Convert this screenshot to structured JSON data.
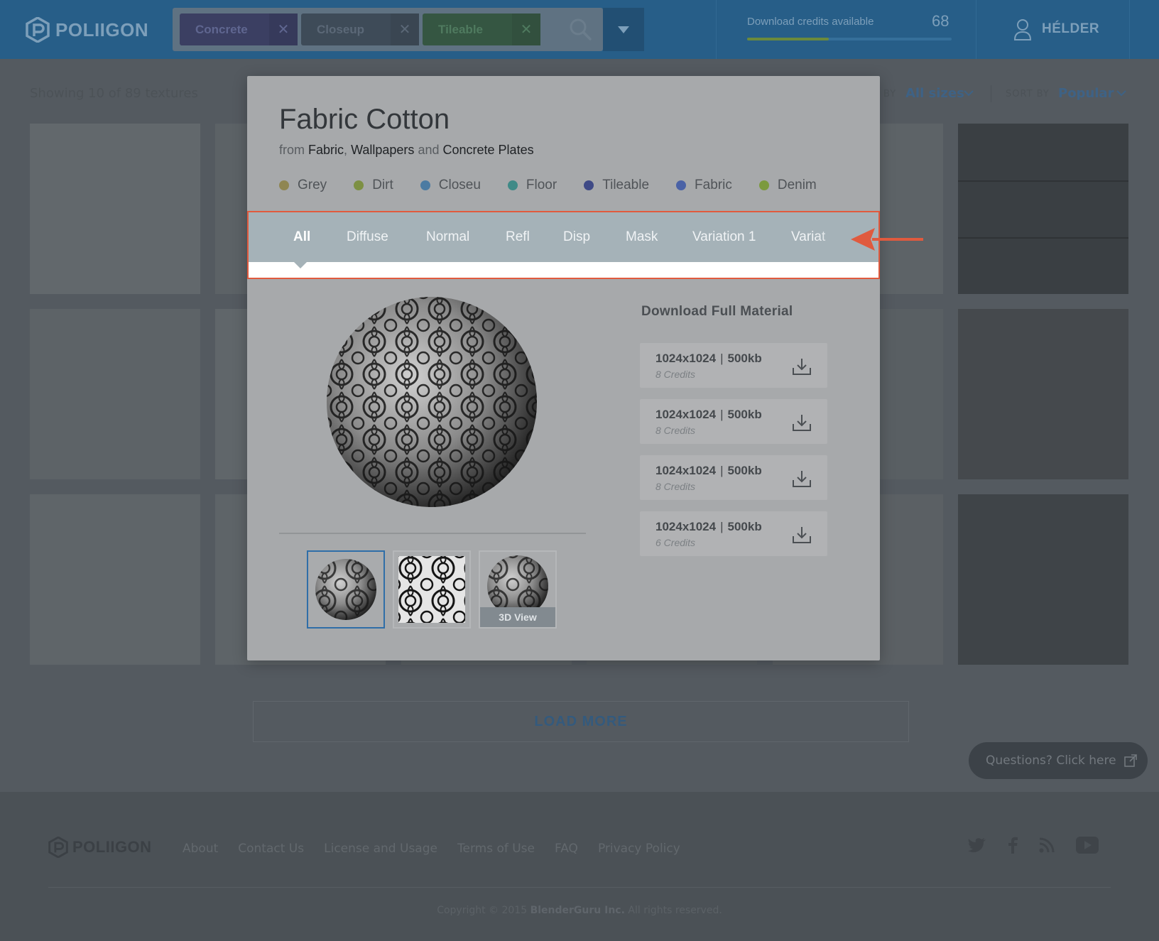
{
  "header": {
    "logo_text": "POLIIGON",
    "search_chips": [
      {
        "label": "Concrete",
        "close": "✕"
      },
      {
        "label": "Closeup",
        "close": "✕"
      },
      {
        "label": "Tileable",
        "close": "✕"
      }
    ],
    "credits_label": "Download credits available",
    "credits_count": "68",
    "credits_progress": 0.4,
    "user_name": "HÉLDER"
  },
  "filters": {
    "showing": "Showing 10 of 89 textures",
    "size_label": "BY",
    "size_value": "All sizes",
    "sort_label": "SORT BY",
    "sort_value": "Popular"
  },
  "load_more": "LOAD MORE",
  "questions": "Questions? Click here",
  "footer": {
    "logo_text": "POLIIGON",
    "links": [
      "About",
      "Contact Us",
      "License and Usage",
      "Terms of Use",
      "FAQ",
      "Privacy Policy"
    ],
    "copyright_prefix": "Copyright © 2015",
    "copyright_company": "BlenderGuru Inc.",
    "copyright_suffix": "All rights reserved."
  },
  "modal": {
    "title": "Fabric Cotton",
    "sub_from": "from",
    "sub_cat1": "Fabric",
    "sub_sep": ",",
    "sub_cat2": "Wallpapers",
    "sub_and": "and",
    "sub_cat3": "Concrete Plates",
    "tags": [
      {
        "label": "Grey",
        "color": "#8f8652"
      },
      {
        "label": "Dirt",
        "color": "#7d9043"
      },
      {
        "label": "Closeu",
        "color": "#4b7ba2"
      },
      {
        "label": "Floor",
        "color": "#3f8a87"
      },
      {
        "label": "Tileable",
        "color": "#3f4a86"
      },
      {
        "label": "Fabric",
        "color": "#4a62a6"
      },
      {
        "label": "Denim",
        "color": "#7c9a3e"
      }
    ],
    "tabs": [
      "All",
      "Diffuse",
      "Normal",
      "Refl",
      "Disp",
      "Mask",
      "Variation 1",
      "Variat"
    ],
    "active_tab": "All",
    "thumb_3d_label": "3D View",
    "download_heading": "Download Full Material",
    "downloads": [
      {
        "size": "1024x1024",
        "file": "500kb",
        "credits": "8 Credits"
      },
      {
        "size": "1024x1024",
        "file": "500kb",
        "credits": "8 Credits"
      },
      {
        "size": "1024x1024",
        "file": "500kb",
        "credits": "8 Credits"
      },
      {
        "size": "1024x1024",
        "file": "500kb",
        "credits": "6 Credits"
      }
    ]
  },
  "colors": {
    "header_bg": "#275e88",
    "overlay_bg": "#545a60",
    "modal_bg": "#a7a9ab",
    "tabbar_bg": "#a5b2b8",
    "highlight": "#e05a3e",
    "active_thumb": "#2f6ea8"
  },
  "icons": [
    "poliigon-logo-icon",
    "close-icon",
    "search-icon",
    "chevron-down-icon",
    "user-icon",
    "download-icon",
    "external-link-icon",
    "twitter-icon",
    "facebook-icon",
    "rss-icon",
    "youtube-icon",
    "arrow-left-icon"
  ]
}
